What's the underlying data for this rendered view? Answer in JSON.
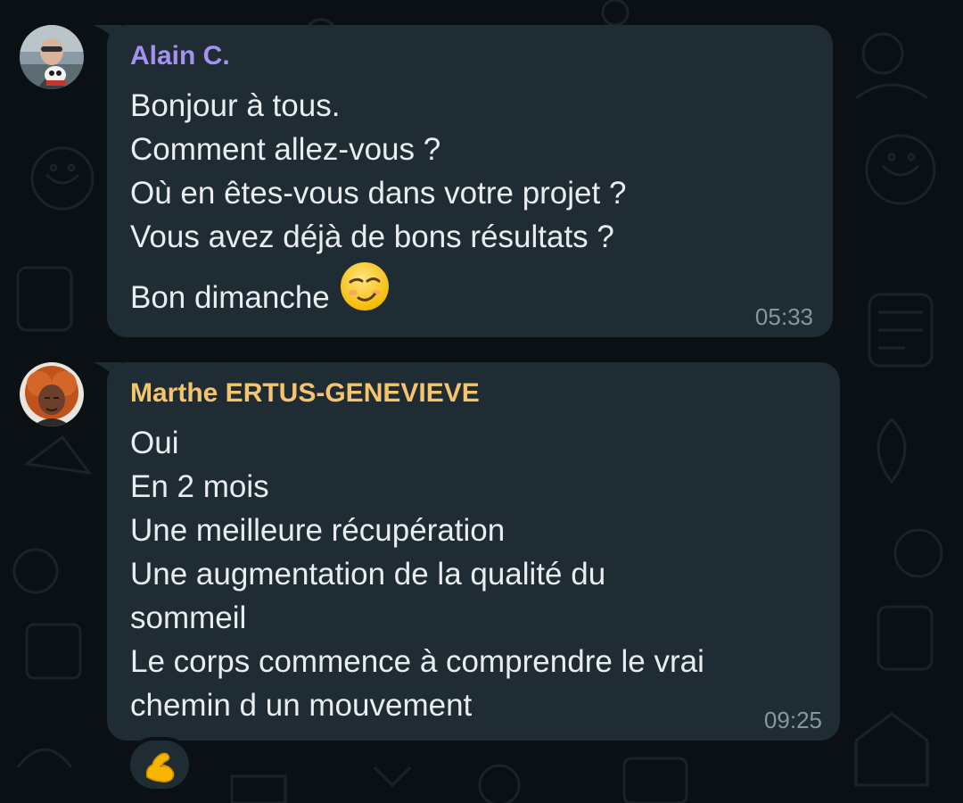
{
  "colors": {
    "background": "#0b1014",
    "bubble": "#1f2c34",
    "message_text": "#e9edef",
    "timestamp": "#8696a0",
    "sender_alain": "#a592f0",
    "sender_marthe": "#f5c56e"
  },
  "messages": [
    {
      "sender": "Alain C.",
      "avatar_icon": "avatar-photo-man-with-dog",
      "lines": [
        "Bonjour à tous.",
        "Comment allez-vous ?",
        "Où en êtes-vous dans votre projet ?",
        "Vous avez déjà de bons résultats ?",
        "Bon dimanche"
      ],
      "inline_emoji": "smirking-face-emoji",
      "time": "05:33"
    },
    {
      "sender": "Marthe ERTUS-GENEVIEVE",
      "avatar_icon": "avatar-photo-woman-red-hair",
      "lines": [
        "Oui",
        "En 2 mois",
        "Une meilleure récupération",
        "Une augmentation de la qualité du",
        "sommeil",
        "Le corps commence à comprendre le vrai",
        "chemin d un mouvement"
      ],
      "time": "09:25",
      "reaction": "flexed-biceps-emoji"
    }
  ]
}
